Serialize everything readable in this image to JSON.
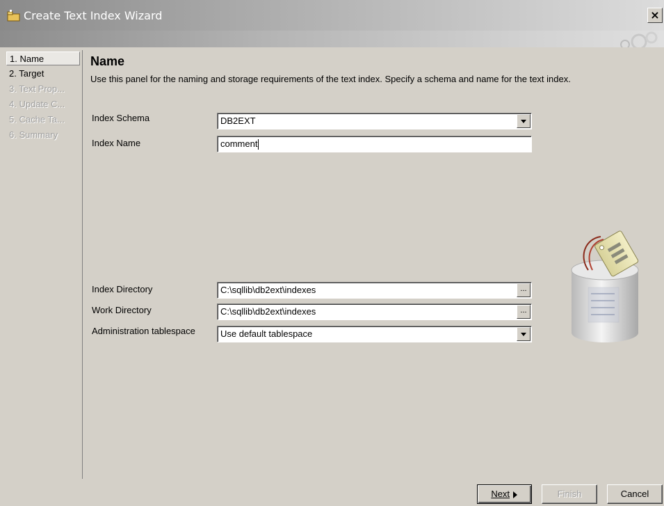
{
  "window": {
    "title": "Create Text Index Wizard",
    "close_label": "×"
  },
  "sidebar": {
    "items": [
      {
        "label": "1. Name",
        "state": "active"
      },
      {
        "label": "2. Target",
        "state": "enabled"
      },
      {
        "label": "3. Text Prop...",
        "state": "disabled"
      },
      {
        "label": "4. Update C...",
        "state": "disabled"
      },
      {
        "label": "5. Cache Ta...",
        "state": "disabled"
      },
      {
        "label": "6. Summary",
        "state": "disabled"
      }
    ]
  },
  "main": {
    "heading": "Name",
    "description": "Use this panel for the naming and storage requirements of the text index. Specify a schema and name for the text index.",
    "fields": {
      "index_schema": {
        "label": "Index Schema",
        "value": "DB2EXT"
      },
      "index_name": {
        "label": "Index Name",
        "value": "comment"
      },
      "index_directory": {
        "label": "Index Directory",
        "value": "C:\\sqllib\\db2ext\\indexes",
        "button": "..."
      },
      "work_directory": {
        "label": "Work Directory",
        "value": "C:\\sqllib\\db2ext\\indexes",
        "button": "..."
      },
      "admin_tablespace": {
        "label": "Administration tablespace",
        "value": "Use default tablespace"
      }
    }
  },
  "footer": {
    "next_label": "Next",
    "finish_label": "Finish",
    "cancel_label": "Cancel"
  },
  "icons": {
    "dropdown": "chevron-down-icon",
    "next": "triangle-right-icon",
    "app": "wizard-icon",
    "illustration": "database-cylinder-icon"
  }
}
